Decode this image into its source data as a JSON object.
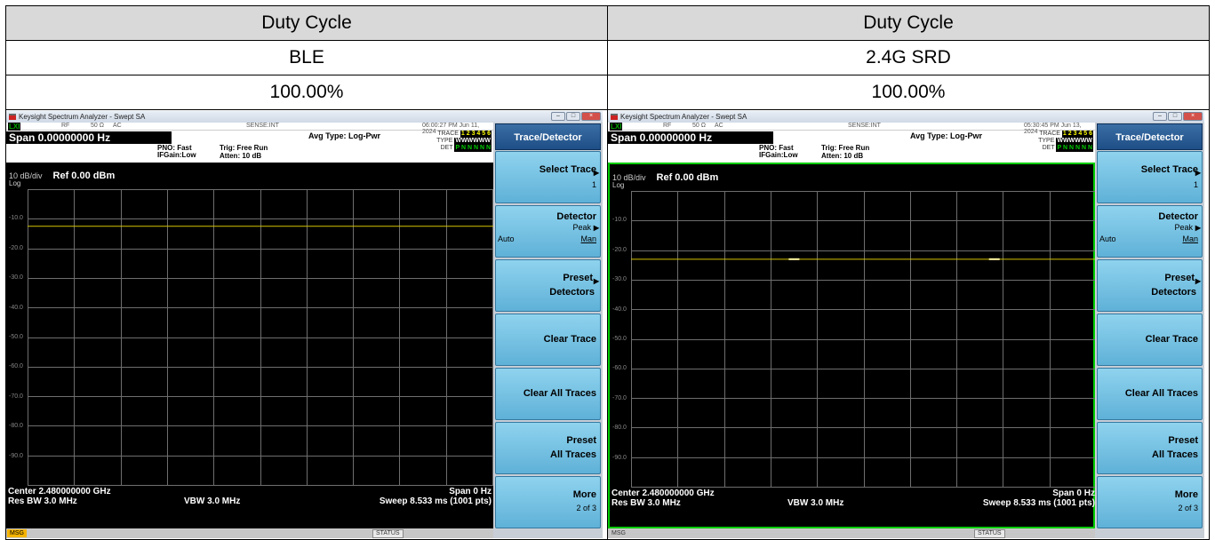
{
  "table": {
    "headers": [
      "Duty Cycle",
      "Duty Cycle"
    ],
    "modes": [
      "BLE",
      "2.4G SRD"
    ],
    "duty_values": [
      "100.00%",
      "100.00%"
    ]
  },
  "analyzers": [
    {
      "window_title": "Keysight Spectrum Analyzer - Swept SA",
      "lxi": "LXI",
      "rf": "RF",
      "impedance": "50 Ω",
      "coupling": "AC",
      "sense": "SENSE:INT",
      "timestamp": "06:00:27 PM Jun 11, 2024",
      "span_top": "Span 0.00000000 Hz",
      "pno": "PNO: Fast",
      "ifgain": "IFGain:Low",
      "trig": "Trig: Free Run",
      "atten": "Atten: 10 dB",
      "avg_type": "Avg Type: Log-Pwr",
      "trace_label": "TRACE",
      "trace_digits": "1 2 3 4 5 6",
      "type_label": "TYPE",
      "type_values": "WWWWWW",
      "det_label": "DET",
      "det_values": "P N N N N N",
      "scale": "10 dB/div",
      "ref_level": "Ref 0.00 dBm",
      "log": "Log",
      "y_labels": [
        "-10.0",
        "-20.0",
        "-30.0",
        "-40.0",
        "-50.0",
        "-60.0",
        "-70.0",
        "-80.0",
        "-90.0"
      ],
      "trace_level_db": -12.5,
      "trace_peaks": [],
      "center": "Center 2.480000000 GHz",
      "span_bottom": "Span 0 Hz",
      "res_bw": "Res BW 3.0 MHz",
      "vbw": "VBW 3.0 MHz",
      "sweep": "Sweep  8.533 ms (1001 pts)",
      "msg": "MSG",
      "msg_warn": true,
      "status": "STATUS",
      "green_border": false,
      "panel_title": "Trace/Detector",
      "softkeys": {
        "select_trace": "Select Trace",
        "select_trace_sub": "1",
        "detector": "Detector",
        "detector_sub": "Peak",
        "auto": "Auto",
        "man": "Man",
        "preset_detectors_1": "Preset",
        "preset_detectors_2": "Detectors",
        "clear_trace": "Clear Trace",
        "clear_all_traces": "Clear All Traces",
        "preset_all_1": "Preset",
        "preset_all_2": "All Traces",
        "more": "More",
        "more_sub": "2 of 3"
      }
    },
    {
      "window_title": "Keysight Spectrum Analyzer - Swept SA",
      "lxi": "LXI",
      "rf": "RF",
      "impedance": "50 Ω",
      "coupling": "AC",
      "sense": "SENSE:INT",
      "timestamp": "05:30:45 PM Jun 13, 2024",
      "span_top": "Span 0.00000000 Hz",
      "pno": "PNO: Fast",
      "ifgain": "IFGain:Low",
      "trig": "Trig: Free Run",
      "atten": "Atten: 10 dB",
      "avg_type": "Avg Type: Log-Pwr",
      "trace_label": "TRACE",
      "trace_digits": "1 2 3 4 5 6",
      "type_label": "TYPE",
      "type_values": "WWWWWW",
      "det_label": "DET",
      "det_values": "P N N N N N",
      "scale": "10 dB/div",
      "ref_level": "Ref 0.00 dBm",
      "log": "Log",
      "y_labels": [
        "-10.0",
        "-20.0",
        "-30.0",
        "-40.0",
        "-50.0",
        "-60.0",
        "-70.0",
        "-80.0",
        "-90.0"
      ],
      "trace_level_db": -23,
      "trace_peaks": [
        0.35,
        0.78
      ],
      "center": "Center 2.480000000 GHz",
      "span_bottom": "Span 0 Hz",
      "res_bw": "Res BW 3.0 MHz",
      "vbw": "VBW 3.0 MHz",
      "sweep": "Sweep  8.533 ms (1001 pts)",
      "msg": "MSG",
      "msg_warn": false,
      "status": "STATUS",
      "green_border": true,
      "panel_title": "Trace/Detector",
      "softkeys": {
        "select_trace": "Select Trace",
        "select_trace_sub": "1",
        "detector": "Detector",
        "detector_sub": "Peak",
        "auto": "Auto",
        "man": "Man",
        "preset_detectors_1": "Preset",
        "preset_detectors_2": "Detectors",
        "clear_trace": "Clear Trace",
        "clear_all_traces": "Clear All Traces",
        "preset_all_1": "Preset",
        "preset_all_2": "All Traces",
        "more": "More",
        "more_sub": "2 of 3"
      }
    }
  ],
  "colors": {
    "trace": "#d4c400",
    "grid": "#6e6e6e",
    "softkey": "#6fc0e4",
    "panel_title": "#2a5a95",
    "active_border": "#00cc00"
  }
}
